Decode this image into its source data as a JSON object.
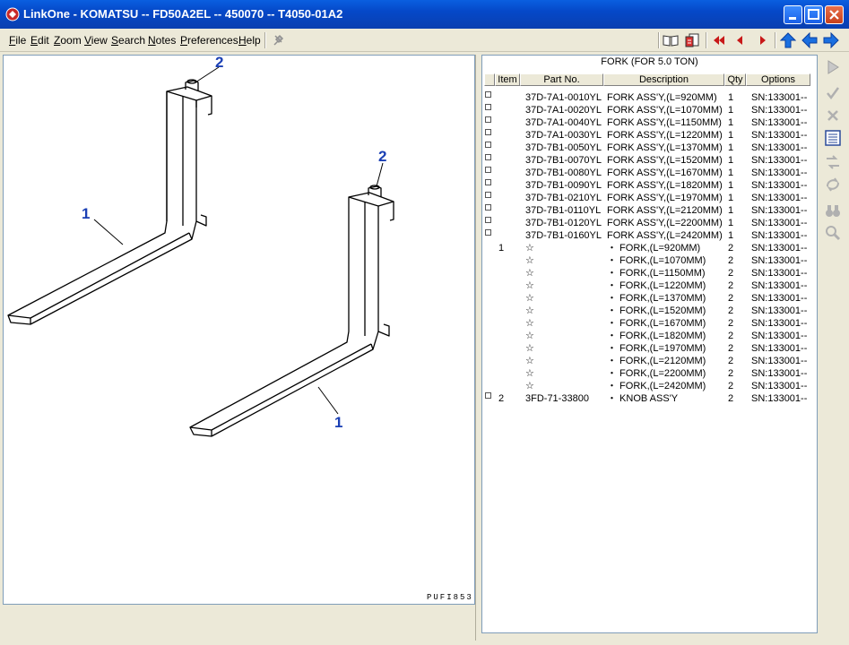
{
  "window": {
    "title": "LinkOne - KOMATSU -- FD50A2EL -- 450070 -- T4050-01A2"
  },
  "menu": [
    {
      "key": "F",
      "rest": "ile"
    },
    {
      "key": "E",
      "rest": "dit"
    },
    {
      "key": "Z",
      "rest": "oom"
    },
    {
      "key": "V",
      "rest": "iew"
    },
    {
      "key": "S",
      "rest": "earch"
    },
    {
      "key": "N",
      "rest": "otes"
    },
    {
      "key": "P",
      "rest": "references"
    },
    {
      "key": "H",
      "rest": "elp"
    }
  ],
  "drawing": {
    "callouts": [
      "2",
      "2",
      "1",
      "1"
    ],
    "code": "PUFI853"
  },
  "grid": {
    "title": "FORK (FOR 5.0 TON)",
    "columns": [
      "Item",
      "Part No.",
      "Description",
      "Qty",
      "Options"
    ],
    "rows": [
      {
        "cb": true,
        "item": "",
        "part": "37D-7A1-0010YL",
        "desc": "FORK ASS'Y,(L=920MM)",
        "qty": "1",
        "opt": "SN:133001--"
      },
      {
        "cb": true,
        "item": "",
        "part": "37D-7A1-0020YL",
        "desc": "FORK ASS'Y,(L=1070MM)",
        "qty": "1",
        "opt": "SN:133001--"
      },
      {
        "cb": true,
        "item": "",
        "part": "37D-7A1-0040YL",
        "desc": "FORK ASS'Y,(L=1150MM)",
        "qty": "1",
        "opt": "SN:133001--"
      },
      {
        "cb": true,
        "item": "",
        "part": "37D-7A1-0030YL",
        "desc": "FORK ASS'Y,(L=1220MM)",
        "qty": "1",
        "opt": "SN:133001--"
      },
      {
        "cb": true,
        "item": "",
        "part": "37D-7B1-0050YL",
        "desc": "FORK ASS'Y,(L=1370MM)",
        "qty": "1",
        "opt": "SN:133001--"
      },
      {
        "cb": true,
        "item": "",
        "part": "37D-7B1-0070YL",
        "desc": "FORK ASS'Y,(L=1520MM)",
        "qty": "1",
        "opt": "SN:133001--"
      },
      {
        "cb": true,
        "item": "",
        "part": "37D-7B1-0080YL",
        "desc": "FORK ASS'Y,(L=1670MM)",
        "qty": "1",
        "opt": "SN:133001--"
      },
      {
        "cb": true,
        "item": "",
        "part": "37D-7B1-0090YL",
        "desc": "FORK ASS'Y,(L=1820MM)",
        "qty": "1",
        "opt": "SN:133001--"
      },
      {
        "cb": true,
        "item": "",
        "part": "37D-7B1-0210YL",
        "desc": "FORK ASS'Y,(L=1970MM)",
        "qty": "1",
        "opt": "SN:133001--"
      },
      {
        "cb": true,
        "item": "",
        "part": "37D-7B1-0110YL",
        "desc": "FORK ASS'Y,(L=2120MM)",
        "qty": "1",
        "opt": "SN:133001--"
      },
      {
        "cb": true,
        "item": "",
        "part": "37D-7B1-0120YL",
        "desc": "FORK ASS'Y,(L=2200MM)",
        "qty": "1",
        "opt": "SN:133001--"
      },
      {
        "cb": true,
        "item": "",
        "part": "37D-7B1-0160YL",
        "desc": "FORK ASS'Y,(L=2420MM)",
        "qty": "1",
        "opt": "SN:133001--"
      },
      {
        "cb": false,
        "item": "1",
        "part": "☆",
        "desc": "・ FORK,(L=920MM)",
        "qty": "2",
        "opt": "SN:133001--"
      },
      {
        "cb": false,
        "item": "",
        "part": "☆",
        "desc": "・ FORK,(L=1070MM)",
        "qty": "2",
        "opt": "SN:133001--"
      },
      {
        "cb": false,
        "item": "",
        "part": "☆",
        "desc": "・ FORK,(L=1150MM)",
        "qty": "2",
        "opt": "SN:133001--"
      },
      {
        "cb": false,
        "item": "",
        "part": "☆",
        "desc": "・ FORK,(L=1220MM)",
        "qty": "2",
        "opt": "SN:133001--"
      },
      {
        "cb": false,
        "item": "",
        "part": "☆",
        "desc": "・ FORK,(L=1370MM)",
        "qty": "2",
        "opt": "SN:133001--"
      },
      {
        "cb": false,
        "item": "",
        "part": "☆",
        "desc": "・ FORK,(L=1520MM)",
        "qty": "2",
        "opt": "SN:133001--"
      },
      {
        "cb": false,
        "item": "",
        "part": "☆",
        "desc": "・ FORK,(L=1670MM)",
        "qty": "2",
        "opt": "SN:133001--"
      },
      {
        "cb": false,
        "item": "",
        "part": "☆",
        "desc": "・ FORK,(L=1820MM)",
        "qty": "2",
        "opt": "SN:133001--"
      },
      {
        "cb": false,
        "item": "",
        "part": "☆",
        "desc": "・ FORK,(L=1970MM)",
        "qty": "2",
        "opt": "SN:133001--"
      },
      {
        "cb": false,
        "item": "",
        "part": "☆",
        "desc": "・ FORK,(L=2120MM)",
        "qty": "2",
        "opt": "SN:133001--"
      },
      {
        "cb": false,
        "item": "",
        "part": "☆",
        "desc": "・ FORK,(L=2200MM)",
        "qty": "2",
        "opt": "SN:133001--"
      },
      {
        "cb": false,
        "item": "",
        "part": "☆",
        "desc": "・ FORK,(L=2420MM)",
        "qty": "2",
        "opt": "SN:133001--"
      },
      {
        "cb": true,
        "item": "2",
        "part": "3FD-71-33800",
        "desc": "・ KNOB ASS'Y",
        "qty": "2",
        "opt": "SN:133001--"
      }
    ]
  },
  "colors": {
    "titlebar": "#0548c8",
    "callout": "#1a3fb4",
    "nav_red": "#c81818",
    "nav_blue": "#1a6fe0"
  },
  "icons": [
    "linkone-app-icon",
    "minimize-icon",
    "maximize-icon",
    "close-icon",
    "pin-icon",
    "book-icon",
    "picklist-icon",
    "first-page-icon",
    "previous-page-icon",
    "next-page-icon",
    "up-level-icon",
    "back-icon",
    "forward-icon",
    "play-icon",
    "check-icon",
    "cross-icon",
    "list-icon",
    "exchange-icon",
    "exchange2-icon",
    "binoculars-icon",
    "magnifier-icon"
  ]
}
